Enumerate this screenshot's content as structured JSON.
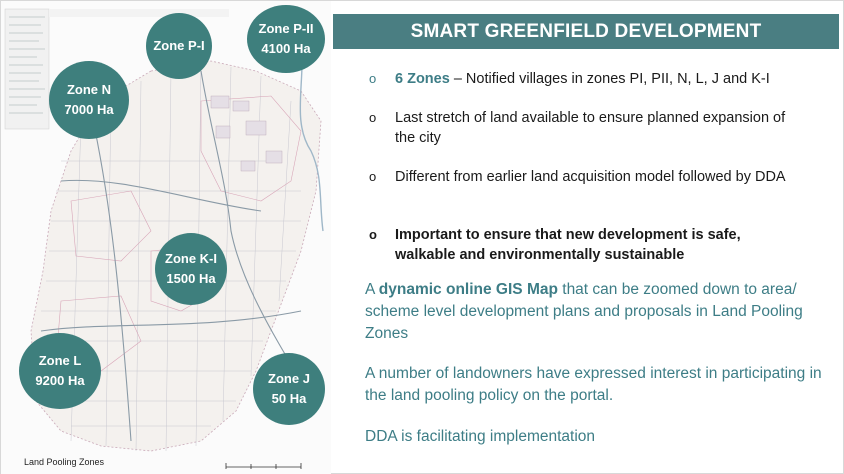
{
  "title": "SMART GREENFIELD DEVELOPMENT",
  "bullets": [
    {
      "highlight": "6 Zones",
      "text": " – Notified villages in zones PI, PII, N, L, J and K-I"
    },
    {
      "text": "Last stretch of land available to ensure planned expansion of the city"
    },
    {
      "text": "Different from earlier land acquisition model followed by DDA"
    },
    {
      "text": "Important to ensure that new development is safe, walkable and environmentally sustainable"
    }
  ],
  "bullet_marker": "o",
  "paragraphs": {
    "p1_prefix": "A ",
    "p1_highlight": "dynamic online GIS Map",
    "p1_suffix": " that can be zoomed down to area/ scheme level development plans and proposals in Land Pooling Zones",
    "p2": "A number of landowners have expressed interest in participating in the land pooling policy on the portal.",
    "p3": "DDA is facilitating implementation"
  },
  "map": {
    "caption": "Land Pooling Zones",
    "zones": [
      {
        "name": "Zone P-I",
        "area": ""
      },
      {
        "name": "Zone P-II",
        "area": "4100 Ha"
      },
      {
        "name": "Zone N",
        "area": "7000 Ha"
      },
      {
        "name": "Zone K-I",
        "area": "1500 Ha"
      },
      {
        "name": "Zone L",
        "area": "9200 Ha"
      },
      {
        "name": "Zone J",
        "area": "50 Ha"
      }
    ]
  },
  "colors": {
    "accent": "#3d7d86",
    "title_bar": "#4a7e82",
    "zone_circle": "#3e7f7d"
  }
}
